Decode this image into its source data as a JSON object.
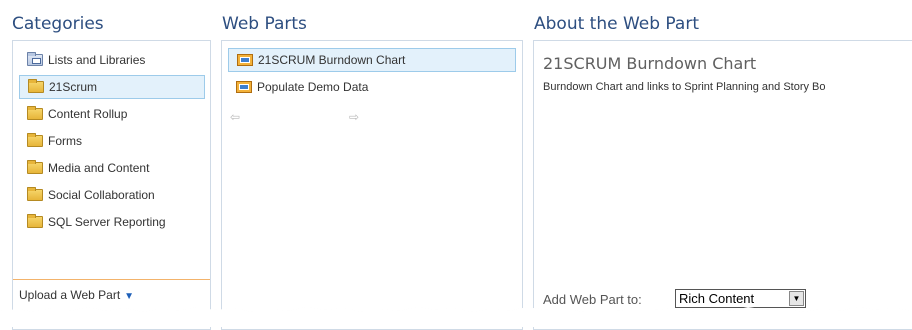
{
  "columns": {
    "categories": "Categories",
    "web_parts": "Web Parts",
    "about": "About the Web Part"
  },
  "categories": [
    {
      "label": "Lists and Libraries",
      "icon": "library-folder-icon",
      "selected": false
    },
    {
      "label": "21Scrum",
      "icon": "folder-icon",
      "selected": true
    },
    {
      "label": "Content Rollup",
      "icon": "folder-icon",
      "selected": false
    },
    {
      "label": "Forms",
      "icon": "folder-icon",
      "selected": false
    },
    {
      "label": "Media and Content",
      "icon": "folder-icon",
      "selected": false
    },
    {
      "label": "Social Collaboration",
      "icon": "folder-icon",
      "selected": false
    },
    {
      "label": "SQL Server Reporting",
      "icon": "folder-icon",
      "selected": false
    }
  ],
  "upload": {
    "label": "Upload a Web Part",
    "icon": "dropdown-triangle-icon"
  },
  "web_parts": [
    {
      "label": "21SCRUM Burndown Chart",
      "icon": "web-part-icon",
      "selected": true
    },
    {
      "label": "Populate Demo Data",
      "icon": "web-part-icon",
      "selected": false
    }
  ],
  "pager": {
    "prev": "⇦",
    "next": "⇨",
    "prev_icon": "left-arrow-icon",
    "next_icon": "right-arrow-icon"
  },
  "about": {
    "title": "21SCRUM Burndown Chart",
    "description": "Burndown Chart and links to Sprint Planning and Story Bo"
  },
  "add_to": {
    "label": "Add Web Part to:",
    "value": "Rich Content"
  },
  "colors": {
    "accent": "#2d4e80",
    "selection_bg": "#e3f1fb",
    "selection_border": "#9dcbea",
    "separator": "#f3b36b"
  }
}
